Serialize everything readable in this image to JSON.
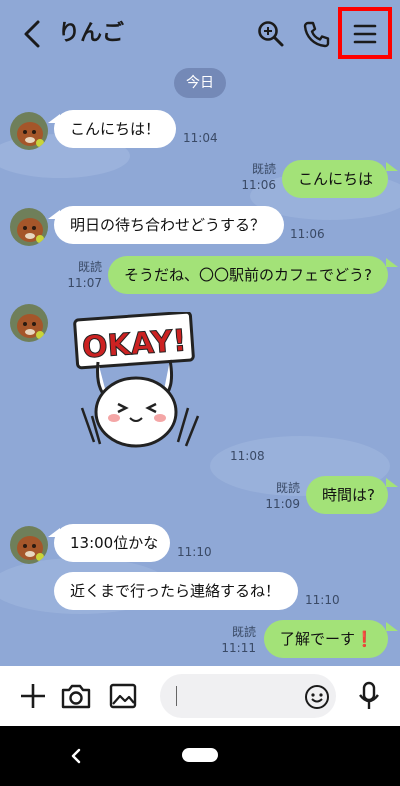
{
  "header": {
    "title": "りんご"
  },
  "date_divider": "今日",
  "messages": [
    {
      "text": "こんにちは！",
      "time": "11:04"
    },
    {
      "text": "こんにちは",
      "time": "11:06",
      "read": "既読"
    },
    {
      "text": "明日の待ち合わせどうする？",
      "time": "11:06"
    },
    {
      "text": "そうだね、〇〇駅前のカフェでどう?",
      "time": "11:07",
      "read": "既読"
    },
    {
      "sticker_text": "OKAY!",
      "time": "11:08"
    },
    {
      "text": "時間は?",
      "time": "11:09",
      "read": "既読"
    },
    {
      "text": "13:00位かな",
      "time": "11:10"
    },
    {
      "text": "近くまで行ったら連絡するね！",
      "time": "11:10"
    },
    {
      "text": "了解でーす",
      "emoji": "❗",
      "time": "11:11",
      "read": "既読"
    }
  ],
  "colors": {
    "background": "#8fa8d6",
    "incoming_bubble": "#ffffff",
    "outgoing_bubble": "#a3e278",
    "highlight_box": "#ff0000",
    "date_pill": "#7489b7"
  },
  "icons": {
    "back": "back-arrow-icon",
    "search": "search-icon",
    "call": "phone-icon",
    "menu": "menu-icon",
    "plus": "plus-icon",
    "camera": "camera-icon",
    "image": "image-icon",
    "emoji": "smiley-icon",
    "mic": "microphone-icon"
  }
}
